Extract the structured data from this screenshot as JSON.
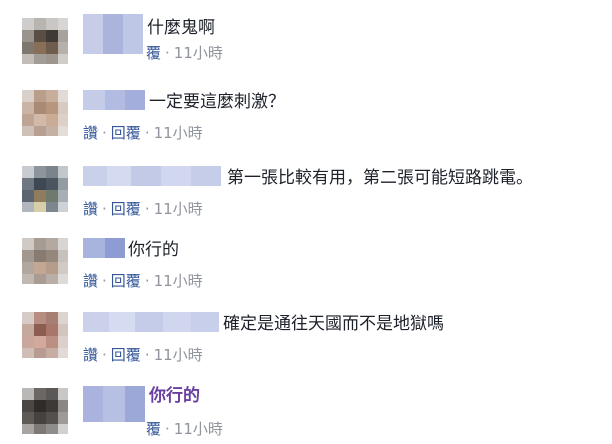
{
  "comments": [
    {
      "text": "什麼鬼啊",
      "actions": {
        "reply": "覆",
        "time": "11小時"
      },
      "highlight": false
    },
    {
      "text": "一定要這麼刺激？",
      "actions": {
        "like": "讚",
        "reply": "回覆",
        "time": "11小時"
      },
      "highlight": false
    },
    {
      "text": "第一張比較有用，第二張可能短路跳電。",
      "actions": {
        "like": "讚",
        "reply": "回覆",
        "time": "11小時"
      },
      "highlight": false
    },
    {
      "text": "你行的",
      "actions": {
        "like": "讚",
        "reply": "回覆",
        "time": "11小時"
      },
      "highlight": false
    },
    {
      "text": "確定是通往天國而不是地獄嗎",
      "actions": {
        "like": "讚",
        "reply": "回覆",
        "time": "11小時"
      },
      "highlight": false
    },
    {
      "text": "你行的",
      "actions": {
        "reply": "覆",
        "time": "11小時"
      },
      "highlight": true
    }
  ],
  "colors": {
    "link": "#365899",
    "meta": "#90949c",
    "text": "#1d2129",
    "highlight": "#6a3fa0",
    "blur_name": "#a9b6e0"
  }
}
